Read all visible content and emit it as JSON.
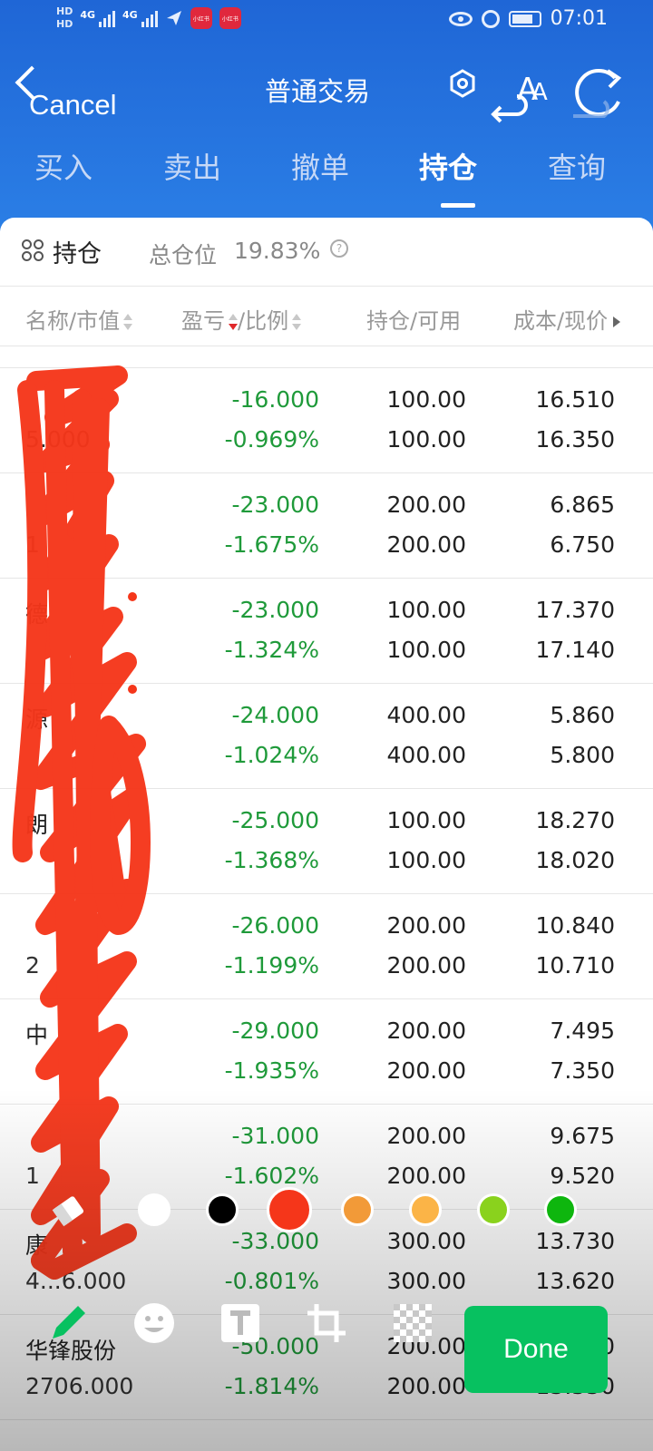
{
  "status_bar": {
    "hd1": "HD",
    "hd2": "HD",
    "net1": "4G",
    "net2": "4G",
    "badge1": "小红书",
    "badge2": "小红书",
    "time": "07:01"
  },
  "nav": {
    "cancel_label": "Cancel",
    "title": "普通交易",
    "icons": [
      "back-icon",
      "hexagon-settings-icon",
      "undo-icon",
      "font-size-icon",
      "refresh-icon"
    ]
  },
  "tabs": [
    {
      "label": "买入"
    },
    {
      "label": "卖出"
    },
    {
      "label": "撤单"
    },
    {
      "label": "持仓",
      "active": true
    },
    {
      "label": "查询"
    }
  ],
  "summary": {
    "title": "持仓",
    "position_label": "总仓位",
    "position_value": "19.83%"
  },
  "table": {
    "headers": [
      "名称/市值",
      "盈亏",
      "/比例",
      "持仓/可用",
      "成本/现价"
    ],
    "rows": [
      {
        "name": "",
        "market_value": "5.000",
        "pl": "-16.000",
        "ratio": "-0.969%",
        "hold": "100.00",
        "avail": "100.00",
        "cost": "16.510",
        "price": "16.350"
      },
      {
        "name": "",
        "market_value": "1",
        "pl": "-23.000",
        "ratio": "-1.675%",
        "hold": "200.00",
        "avail": "200.00",
        "cost": "6.865",
        "price": "6.750"
      },
      {
        "name": "德",
        "market_value": "",
        "pl": "-23.000",
        "ratio": "-1.324%",
        "hold": "100.00",
        "avail": "100.00",
        "cost": "17.370",
        "price": "17.140"
      },
      {
        "name": "源",
        "market_value": "",
        "pl": "-24.000",
        "ratio": "-1.024%",
        "hold": "400.00",
        "avail": "400.00",
        "cost": "5.860",
        "price": "5.800"
      },
      {
        "name": "朗",
        "market_value": "",
        "pl": "-25.000",
        "ratio": "-1.368%",
        "hold": "100.00",
        "avail": "100.00",
        "cost": "18.270",
        "price": "18.020"
      },
      {
        "name": "",
        "market_value": "2",
        "pl": "-26.000",
        "ratio": "-1.199%",
        "hold": "200.00",
        "avail": "200.00",
        "cost": "10.840",
        "price": "10.710"
      },
      {
        "name": "中",
        "market_value": "",
        "pl": "-29.000",
        "ratio": "-1.935%",
        "hold": "200.00",
        "avail": "200.00",
        "cost": "7.495",
        "price": "7.350"
      },
      {
        "name": "",
        "market_value": "1",
        "pl": "-31.000",
        "ratio": "-1.602%",
        "hold": "200.00",
        "avail": "200.00",
        "cost": "9.675",
        "price": "9.520"
      },
      {
        "name": "康",
        "market_value": "4...6.000",
        "pl": "-33.000",
        "ratio": "-0.801%",
        "hold": "300.00",
        "avail": "300.00",
        "cost": "13.730",
        "price": "13.620"
      },
      {
        "name": "华锋股份",
        "market_value": "2706.000",
        "pl": "-50.000",
        "ratio": "-1.814%",
        "hold": "200.00",
        "avail": "200.00",
        "cost": "13.530",
        "price": "13.530"
      }
    ]
  },
  "editor": {
    "swatches": [
      "#ffffff",
      "#000000",
      "#f5361a",
      "#f29a38",
      "#fbb447",
      "#8ad21d",
      "#0eb60e"
    ],
    "selected_color": "#f5361a",
    "done_label": "Done",
    "tools": [
      "pencil-icon",
      "emoji-icon",
      "text-icon",
      "crop-icon",
      "mosaic-icon"
    ]
  }
}
